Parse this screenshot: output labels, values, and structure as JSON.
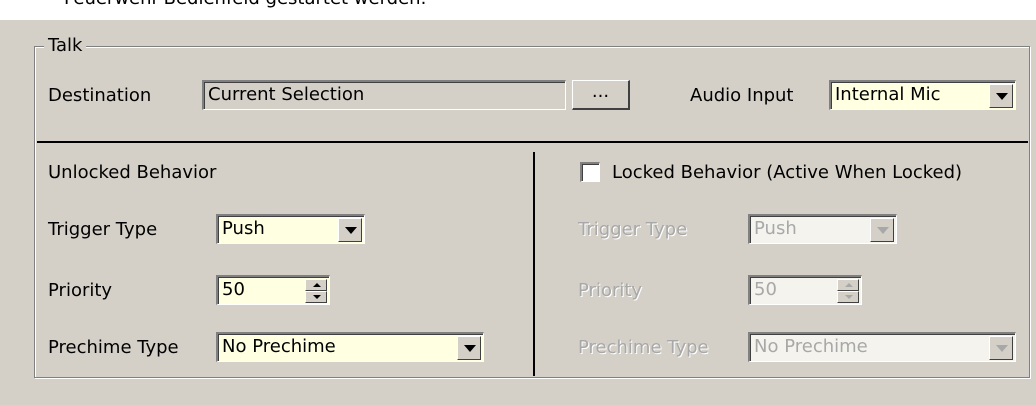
{
  "header_text": "Feuerwehr-Bedienfeld gestartet werden.",
  "group": {
    "legend": "Talk",
    "destination": {
      "label": "Destination",
      "value": "Current Selection",
      "browse_label": "..."
    },
    "audio_input": {
      "label": "Audio Input",
      "value": "Internal Mic"
    }
  },
  "unlocked": {
    "title": "Unlocked Behavior",
    "trigger_label": "Trigger Type",
    "trigger_value": "Push",
    "priority_label": "Priority",
    "priority_value": "50",
    "prechime_label": "Prechime Type",
    "prechime_value": "No Prechime"
  },
  "locked": {
    "checkbox_label": "Locked Behavior (Active When Locked)",
    "checked": false,
    "trigger_label": "Trigger Type",
    "trigger_value": "Push",
    "priority_label": "Priority",
    "priority_value": "50",
    "prechime_label": "Prechime Type",
    "prechime_value": "No Prechime"
  },
  "colors": {
    "dialog_bg": "#d4d0c8",
    "field_yellow": "#ffffe1",
    "disabled_text": "#a8a8a8"
  }
}
